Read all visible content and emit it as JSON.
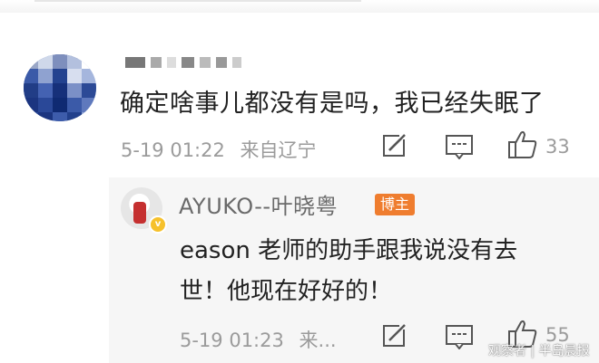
{
  "comment": {
    "text": "确定啥事儿都没有是吗，我已经失眠了",
    "time": "5-19 01:22",
    "location": "来自辽宁",
    "like_count": "33",
    "icons": [
      "share-icon",
      "comment-icon",
      "like-icon"
    ]
  },
  "reply": {
    "author": "AYUKO--叶晓粤",
    "badge": "博主",
    "text_line1": "eason 老师的助手跟我说没有去",
    "text_line2": "世！他现在好好的！",
    "time": "5-19 01:23",
    "location_truncated": "来...",
    "like_count": "55",
    "icons": [
      "share-icon",
      "comment-icon",
      "like-icon"
    ]
  },
  "watermark": "观察者 | 半岛晨报",
  "colors": {
    "badge": "#ef7d2f",
    "meta_text": "#9b9b9b",
    "reply_bg": "#f6f6f6",
    "v_badge": "#f6c12c"
  }
}
